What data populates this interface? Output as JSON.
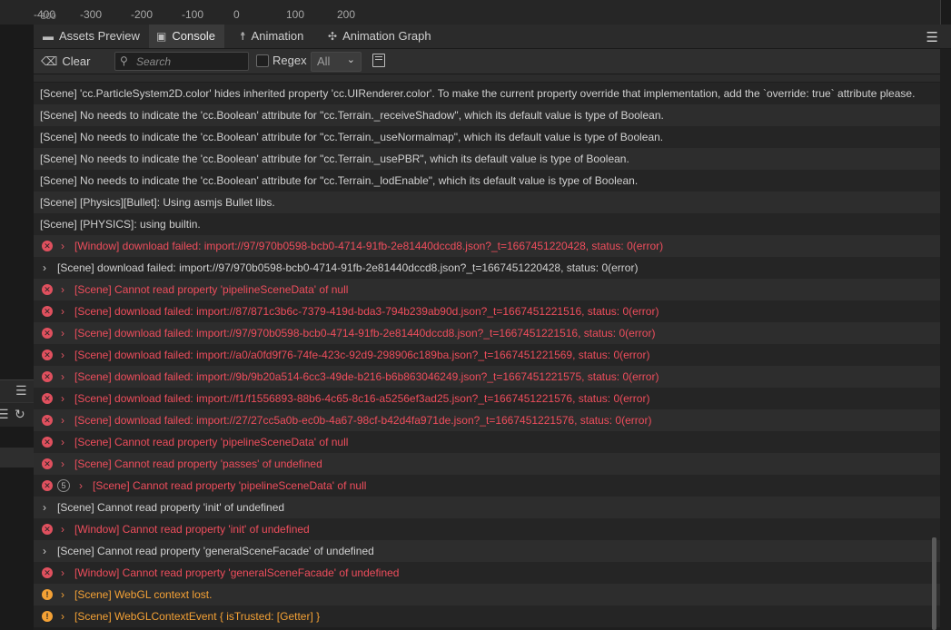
{
  "ruler": {
    "ticks": [
      "-400",
      "-300",
      "-200",
      "-100",
      "0",
      "100",
      "200"
    ],
    "overlap_tick": "100"
  },
  "tabs": [
    {
      "label": "Assets Preview",
      "icon": "folder-icon",
      "active": false
    },
    {
      "label": "Console",
      "icon": "terminal-icon",
      "active": true
    },
    {
      "label": "Animation",
      "icon": "running-figure-icon",
      "active": false
    },
    {
      "label": "Animation Graph",
      "icon": "graph-node-icon",
      "active": false
    }
  ],
  "toolbar": {
    "clear_label": "Clear",
    "search_placeholder": "Search",
    "search_value": "",
    "regex_label": "Regex",
    "regex_checked": false,
    "level_value": "All"
  },
  "logs": [
    {
      "level": "log",
      "text": "[Scene] 'cc.ParticleSystem2D.color' hides inherited property 'cc.UIRenderer.color'. To make the current property override that implementation, add the `override: true` attribute please."
    },
    {
      "level": "log",
      "text": "[Scene] No needs to indicate the 'cc.Boolean' attribute for \"cc.Terrain._receiveShadow\", which its default value is type of Boolean."
    },
    {
      "level": "log",
      "text": "[Scene] No needs to indicate the 'cc.Boolean' attribute for \"cc.Terrain._useNormalmap\", which its default value is type of Boolean."
    },
    {
      "level": "log",
      "text": "[Scene] No needs to indicate the 'cc.Boolean' attribute for \"cc.Terrain._usePBR\", which its default value is type of Boolean."
    },
    {
      "level": "log",
      "text": "[Scene] No needs to indicate the 'cc.Boolean' attribute for \"cc.Terrain._lodEnable\", which its default value is type of Boolean."
    },
    {
      "level": "log",
      "text": "[Scene] [Physics][Bullet]: Using asmjs Bullet libs."
    },
    {
      "level": "log",
      "text": "[Scene] [PHYSICS]: using builtin."
    },
    {
      "level": "error",
      "text": "[Window] download failed: import://97/970b0598-bcb0-4714-91fb-2e81440dccd8.json?_t=1667451220428, status: 0(error)"
    },
    {
      "level": "info",
      "text": "[Scene] download failed: import://97/970b0598-bcb0-4714-91fb-2e81440dccd8.json?_t=1667451220428, status: 0(error)"
    },
    {
      "level": "error",
      "text": "[Scene] Cannot read property 'pipelineSceneData' of null"
    },
    {
      "level": "error",
      "text": "[Scene] download failed: import://87/871c3b6c-7379-419d-bda3-794b239ab90d.json?_t=1667451221516, status: 0(error)"
    },
    {
      "level": "error",
      "text": "[Scene] download failed: import://97/970b0598-bcb0-4714-91fb-2e81440dccd8.json?_t=1667451221516, status: 0(error)"
    },
    {
      "level": "error",
      "text": "[Scene] download failed: import://a0/a0fd9f76-74fe-423c-92d9-298906c189ba.json?_t=1667451221569, status: 0(error)"
    },
    {
      "level": "error",
      "text": "[Scene] download failed: import://9b/9b20a514-6cc3-49de-b216-b6b863046249.json?_t=1667451221575, status: 0(error)"
    },
    {
      "level": "error",
      "text": "[Scene] download failed: import://f1/f1556893-88b6-4c65-8c16-a5256ef3ad25.json?_t=1667451221576, status: 0(error)"
    },
    {
      "level": "error",
      "text": "[Scene] download failed: import://27/27cc5a0b-ec0b-4a67-98cf-b42d4fa971de.json?_t=1667451221576, status: 0(error)"
    },
    {
      "level": "error",
      "text": "[Scene] Cannot read property 'pipelineSceneData' of null"
    },
    {
      "level": "error",
      "text": "[Scene] Cannot read property 'passes' of undefined"
    },
    {
      "level": "error",
      "count": "5",
      "text": "[Scene] Cannot read property 'pipelineSceneData' of null"
    },
    {
      "level": "info",
      "text": "[Scene] Cannot read property 'init' of undefined"
    },
    {
      "level": "error",
      "text": "[Window] Cannot read property 'init' of undefined"
    },
    {
      "level": "info",
      "text": "[Scene] Cannot read property 'generalSceneFacade' of undefined"
    },
    {
      "level": "error",
      "text": "[Window] Cannot read property 'generalSceneFacade' of undefined"
    },
    {
      "level": "warn",
      "text": "[Scene] WebGL context lost."
    },
    {
      "level": "warn",
      "text": "[Scene] WebGLContextEvent { isTrusted: [Getter] }"
    }
  ],
  "colors": {
    "error_text": "#ee4d5c",
    "warn_text": "#f4a135",
    "log_text": "#d0d0d0",
    "active_tab": "#3a3a3a"
  }
}
